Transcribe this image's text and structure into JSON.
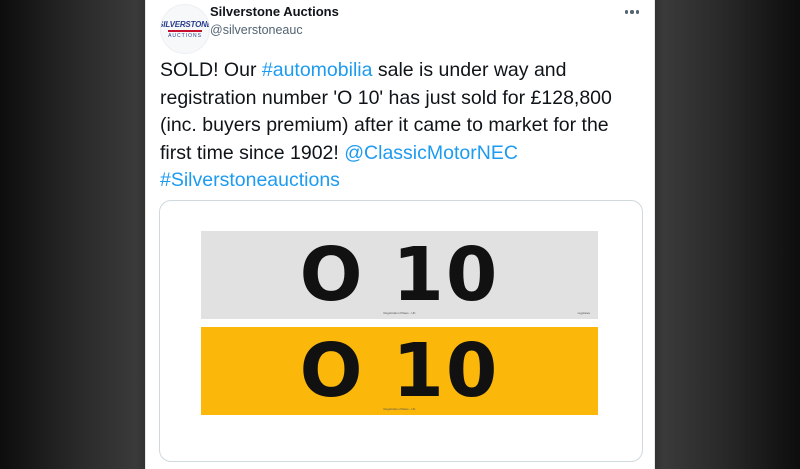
{
  "tweet": {
    "display_name": "Silverstone Auctions",
    "handle": "@silverstoneauc",
    "avatar": {
      "logo_top": "SILVERSTONE",
      "logo_bottom": "AUCTIONS",
      "colors": {
        "brand_blue": "#2a3d8f",
        "brand_red": "#c8102e"
      }
    },
    "more_icon": "more-horizontal-icon",
    "text": {
      "part1": "SOLD! Our ",
      "hashtag1": "#automobilia",
      "part2": " sale is under way and registration number 'O 10' has just sold for £128,800 (inc. buyers premium) after it came to market for the first time since 1902! ",
      "mention": "@ClassicMotorNEC",
      "hashtag2": "#Silverstoneauctions"
    },
    "link_color": "#1d9bf0",
    "media": {
      "front_plate": {
        "registration": "O 10",
        "color": "#e1e1e1",
        "small_text": "Registration Plates - UK",
        "small_right": "regplates"
      },
      "rear_plate": {
        "registration": "O 10",
        "color": "#fbb80a",
        "small_text": "Registration Plates - UK"
      }
    }
  }
}
